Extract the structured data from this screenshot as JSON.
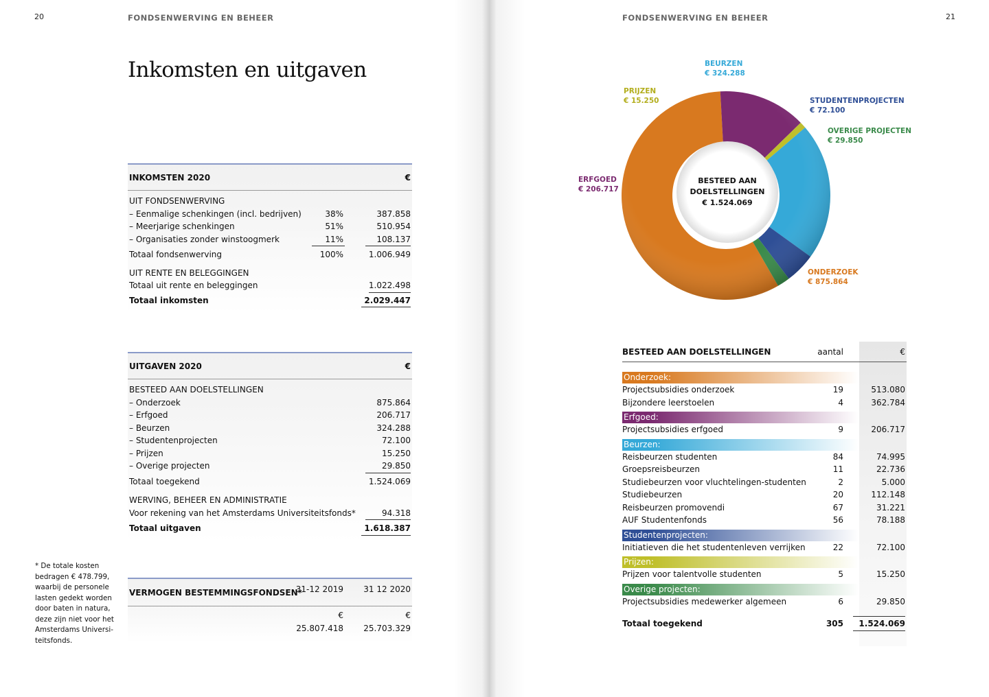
{
  "left_page": {
    "page_number": "20",
    "running_head": "FONDSENWERVING EN BEHEER",
    "title": "Inkomsten en uitgaven",
    "income": {
      "header": "INKOMSTEN 2020",
      "currency": "€",
      "section1_title": "UIT FONDSENWERVING",
      "rows": [
        {
          "label": "– Eenmalige schenkingen (incl. bedrijven)",
          "pct": "38%",
          "amount": "387.858"
        },
        {
          "label": "– Meerjarige schenkingen",
          "pct": "51%",
          "amount": "510.954"
        },
        {
          "label": "– Organisaties zonder winstoogmerk",
          "pct": "11%",
          "amount": "108.137"
        }
      ],
      "subtotal": {
        "label": "Totaal fondsenwerving",
        "pct": "100%",
        "amount": "1.006.949"
      },
      "section2_title": "UIT RENTE EN BELEGGINGEN",
      "interest": {
        "label": "Totaal uit rente en beleggingen",
        "amount": "1.022.498"
      },
      "total": {
        "label": "Totaal inkomsten",
        "amount": "2.029.447"
      }
    },
    "expenses": {
      "header": "UITGAVEN 2020",
      "currency": "€",
      "section1_title": "BESTEED AAN DOELSTELLINGEN",
      "rows": [
        {
          "label": "– Onderzoek",
          "amount": "875.864"
        },
        {
          "label": "– Erfgoed",
          "amount": "206.717"
        },
        {
          "label": "– Beurzen",
          "amount": "324.288"
        },
        {
          "label": "– Studentenprojecten",
          "amount": "72.100"
        },
        {
          "label": "– Prijzen",
          "amount": "15.250"
        },
        {
          "label": "– Overige projecten",
          "amount": "29.850"
        }
      ],
      "subtotal": {
        "label": "Totaal toegekend",
        "amount": "1.524.069"
      },
      "section2_title": "WERVING, BEHEER EN ADMINISTRATIE",
      "admin": {
        "label": "Voor rekening van het Amsterdams Universiteitsfonds*",
        "amount": "94.318"
      },
      "total": {
        "label": "Totaal uitgaven",
        "amount": "1.618.387"
      }
    },
    "funds": {
      "header": "VERMOGEN BESTEMMINGSFONDSEN*",
      "col1": "31-12 2019",
      "col2": "31 12 2020",
      "currency1": "€",
      "currency2": "€",
      "value1": "25.807.418",
      "value2": "25.703.329"
    },
    "footnote": "* De totale kosten bedragen € 478.799, waarbij de personele lasten gedekt worden door baten in natura, deze zijn niet voor het Amsterdams Universi­teitsfonds."
  },
  "right_page": {
    "page_number": "21",
    "running_head": "FONDSENWERVING EN BEHEER",
    "donut_center": [
      "BESTEED AAN",
      "DOELSTELLINGEN",
      "€ 1.524.069"
    ],
    "table": {
      "header": "BESTEED AAN DOELSTELLINGEN",
      "count_header": "aantal",
      "amount_header": "€",
      "categories": [
        {
          "name": "Onderzoek:",
          "color": "#d8791f",
          "rows": [
            {
              "label": "Projectsubsidies onderzoek",
              "count": "19",
              "amount": "513.080"
            },
            {
              "label": "Bijzondere leerstoelen",
              "count": "4",
              "amount": "362.784"
            }
          ]
        },
        {
          "name": "Erfgoed:",
          "color": "#7b2a70",
          "rows": [
            {
              "label": "Projectsubsidies erfgoed",
              "count": "9",
              "amount": "206.717"
            }
          ]
        },
        {
          "name": "Beurzen:",
          "color": "#35a9d8",
          "rows": [
            {
              "label": "Reisbeurzen studenten",
              "count": "84",
              "amount": "74.995"
            },
            {
              "label": "Groepsreisbeurzen",
              "count": "11",
              "amount": "22.736"
            },
            {
              "label": "Studiebeurzen voor vluchtelingen-studenten",
              "count": "2",
              "amount": "5.000"
            },
            {
              "label": "Studiebeurzen",
              "count": "20",
              "amount": "112.148"
            },
            {
              "label": "Reisbeurzen promovendi",
              "count": "67",
              "amount": "31.221"
            },
            {
              "label": "AUF Studentenfonds",
              "count": "56",
              "amount": "78.188"
            }
          ]
        },
        {
          "name": "Studentenprojecten:",
          "color": "#2f4f96",
          "rows": [
            {
              "label": "Initiatieven die het studentenleven verrijken",
              "count": "22",
              "amount": "72.100"
            }
          ]
        },
        {
          "name": "Prijzen:",
          "color": "#bfbf2a",
          "rows": [
            {
              "label": "Prijzen voor talentvolle studenten",
              "count": "5",
              "amount": "15.250"
            }
          ]
        },
        {
          "name": "Overige projecten:",
          "color": "#3a8a4a",
          "rows": [
            {
              "label": "Projectsubsidies medewerker algemeen",
              "count": "6",
              "amount": "29.850"
            }
          ]
        }
      ],
      "total": {
        "label": "Totaal toegekend",
        "count": "305",
        "amount": "1.524.069"
      }
    }
  },
  "chart_data": {
    "type": "pie",
    "style": "donut",
    "categories": [
      "ONDERZOEK",
      "ERFGOED",
      "PRIJZEN",
      "BEURZEN",
      "STUDENTENPROJECTEN",
      "OVERIGE PROJECTEN"
    ],
    "labels": [
      "€ 875.864",
      "€ 206.717",
      "€ 15.250",
      "€ 324.288",
      "€ 72.100",
      "€ 29.850"
    ],
    "values": [
      875864,
      206717,
      15250,
      324288,
      72100,
      29850
    ],
    "colors": [
      "#d8791f",
      "#7b2a70",
      "#bfbf2a",
      "#35a9d8",
      "#2f4f96",
      "#3a8a4a"
    ]
  }
}
